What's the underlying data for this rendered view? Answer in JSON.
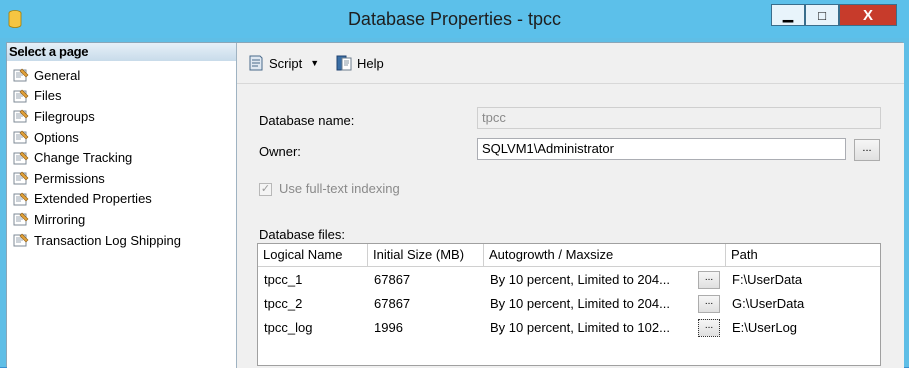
{
  "window": {
    "title": "Database Properties - tpcc",
    "minimize_glyph": "▁",
    "maximize_glyph": "□",
    "close_glyph": "X"
  },
  "left_pane": {
    "header": "Select a page",
    "pages": [
      {
        "label": "General"
      },
      {
        "label": "Files"
      },
      {
        "label": "Filegroups"
      },
      {
        "label": "Options"
      },
      {
        "label": "Change Tracking"
      },
      {
        "label": "Permissions"
      },
      {
        "label": "Extended Properties"
      },
      {
        "label": "Mirroring"
      },
      {
        "label": "Transaction Log Shipping"
      }
    ],
    "selected": "Files"
  },
  "toolbar": {
    "script_label": "Script",
    "help_label": "Help"
  },
  "form": {
    "database_name_label": "Database name:",
    "database_name_value": "tpcc",
    "owner_label": "Owner:",
    "owner_value": "SQLVM1\\Administrator",
    "owner_button": "...",
    "fulltext_label": "Use full-text indexing",
    "fulltext_checked": true,
    "database_files_label": "Database files:"
  },
  "files_grid": {
    "columns": [
      "Logical Name",
      "Initial Size (MB)",
      "Autogrowth / Maxsize",
      "Path"
    ],
    "rows": [
      {
        "logical_name": "tpcc_1",
        "initial_size": "67867",
        "autogrowth": "By 10 percent, Limited to 204...",
        "button": "...",
        "path": "F:\\UserData"
      },
      {
        "logical_name": "tpcc_2",
        "initial_size": "67867",
        "autogrowth": "By 10 percent, Limited to 204...",
        "button": "...",
        "path": "G:\\UserData"
      },
      {
        "logical_name": "tpcc_log",
        "initial_size": "1996",
        "autogrowth": "By 10 percent, Limited to 102...",
        "button": "...",
        "path": "E:\\UserLog"
      }
    ]
  },
  "colors": {
    "titlebar": "#5cc0ea",
    "close_button": "#c73b2b",
    "pane_background": "#f0f0f0"
  }
}
